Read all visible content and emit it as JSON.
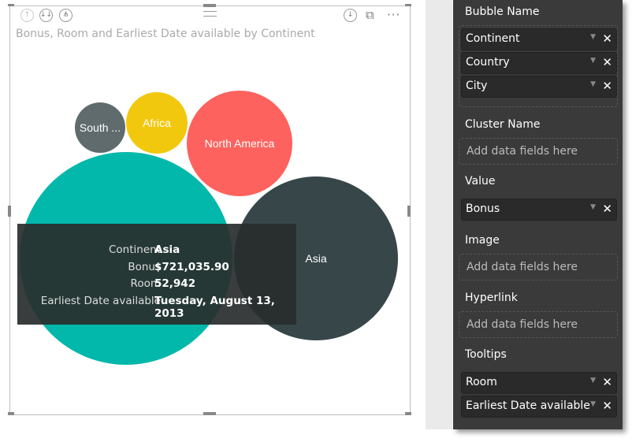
{
  "visual": {
    "title": "Bonus, Room and Earliest Date available by Continent",
    "icons": [
      "drill-up-icon",
      "drill-down-icon",
      "expand-hierarchy-icon",
      "drill-mode-icon",
      "focus-mode-icon",
      "more-options-icon"
    ]
  },
  "chart_data": {
    "type": "bubble",
    "bubbles": [
      {
        "label": "",
        "color": "#01B8AA"
      },
      {
        "label": "Asia",
        "color": "#374649"
      },
      {
        "label": "North America",
        "color": "#FD625E"
      },
      {
        "label": "Africa",
        "color": "#F2C80F"
      },
      {
        "label": "South ...",
        "color": "#5F6B6D"
      }
    ]
  },
  "tooltip": {
    "rows": [
      {
        "k": "Continent",
        "v": "Asia"
      },
      {
        "k": "Bonus",
        "v": "$721,035.90"
      },
      {
        "k": "Room",
        "v": "52,942"
      },
      {
        "k": "Earliest Date available",
        "v": "Tuesday, August 13, 2013"
      }
    ]
  },
  "pane": {
    "bubble_name": {
      "label": "Bubble Name",
      "fields": [
        "Continent",
        "Country",
        "City"
      ]
    },
    "cluster_name": {
      "label": "Cluster Name",
      "placeholder": "Add data fields here"
    },
    "value": {
      "label": "Value",
      "fields": [
        "Bonus"
      ]
    },
    "image": {
      "label": "Image",
      "placeholder": "Add data fields here"
    },
    "hyperlink": {
      "label": "Hyperlink",
      "placeholder": "Add data fields here"
    },
    "tooltips": {
      "label": "Tooltips",
      "fields": [
        "Room",
        "Earliest Date available"
      ]
    },
    "remove_glyph": "✕",
    "dropdown_glyph": "▼"
  }
}
